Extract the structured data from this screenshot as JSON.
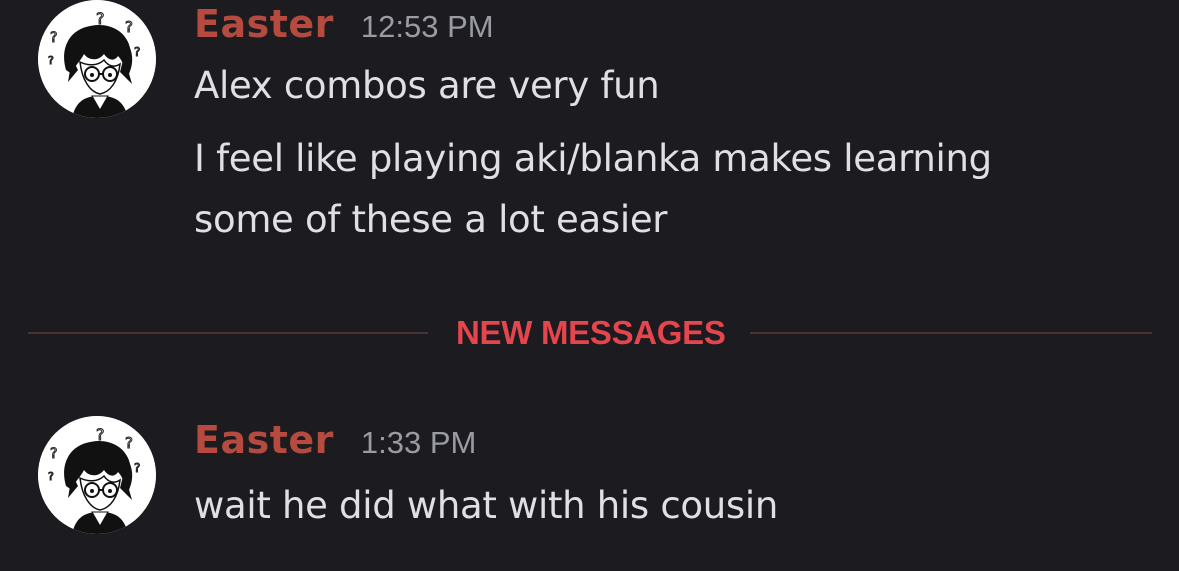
{
  "colors": {
    "background": "#1b1b20",
    "username": "#b54a3f",
    "timestamp": "#9a9ba3",
    "message_text": "#dfe0e4",
    "new_messages_accent": "#e5454d"
  },
  "messages": [
    {
      "author": "Easter",
      "time": "12:53 PM",
      "avatar_icon": "anime-boy-glasses-question-marks-avatar",
      "lines": [
        "Alex combos are very fun",
        "I feel like playing aki/blanka makes learning",
        "some of these a lot easier"
      ]
    },
    {
      "author": "Easter",
      "time": "1:33 PM",
      "avatar_icon": "anime-boy-glasses-question-marks-avatar",
      "lines": [
        "wait he did what with his cousin"
      ]
    }
  ],
  "divider": {
    "label": "NEW MESSAGES"
  }
}
